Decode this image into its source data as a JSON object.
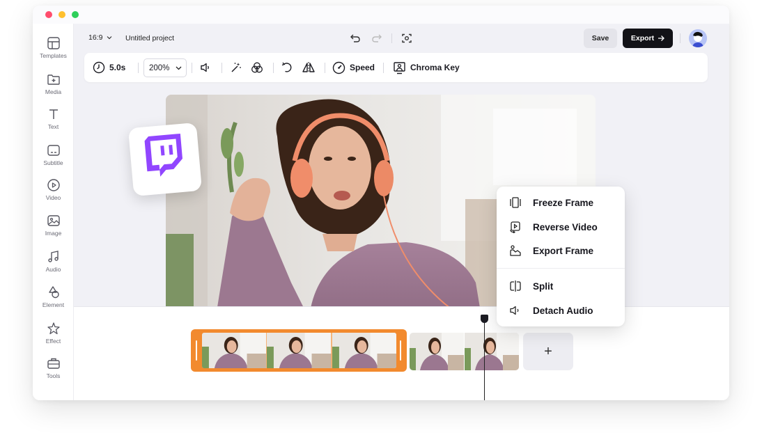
{
  "window": {
    "traffic_lights": [
      "#ff4d6d",
      "#ffc02e",
      "#2ecf5a"
    ]
  },
  "sidebar": {
    "items": [
      {
        "label": "Templates",
        "icon": "templates-icon"
      },
      {
        "label": "Media",
        "icon": "media-icon"
      },
      {
        "label": "Text",
        "icon": "text-icon"
      },
      {
        "label": "Subtitle",
        "icon": "subtitle-icon"
      },
      {
        "label": "Video",
        "icon": "video-icon"
      },
      {
        "label": "Image",
        "icon": "image-icon"
      },
      {
        "label": "Audio",
        "icon": "audio-icon"
      },
      {
        "label": "Element",
        "icon": "element-icon"
      },
      {
        "label": "Effect",
        "icon": "effect-icon"
      },
      {
        "label": "Tools",
        "icon": "tools-icon"
      }
    ]
  },
  "topbar": {
    "aspect_ratio": "16:9",
    "project_name": "Untitled project",
    "save_label": "Save",
    "export_label": "Export"
  },
  "toolbar": {
    "duration": "5.0s",
    "zoom": "200%",
    "speed_label": "Speed",
    "chroma_label": "Chroma Key"
  },
  "context_menu": {
    "items": [
      {
        "label": "Freeze Frame",
        "icon": "freeze-frame-icon"
      },
      {
        "label": "Reverse Video",
        "icon": "reverse-video-icon"
      },
      {
        "label": "Export Frame",
        "icon": "export-frame-icon"
      },
      {
        "label": "Split",
        "icon": "split-icon"
      },
      {
        "label": "Detach Audio",
        "icon": "detach-audio-icon"
      }
    ]
  },
  "timeline": {
    "add_label": "+"
  },
  "colors": {
    "accent_clip": "#f28a2e",
    "twitch_purple": "#9146ff",
    "export_button": "#121217"
  }
}
